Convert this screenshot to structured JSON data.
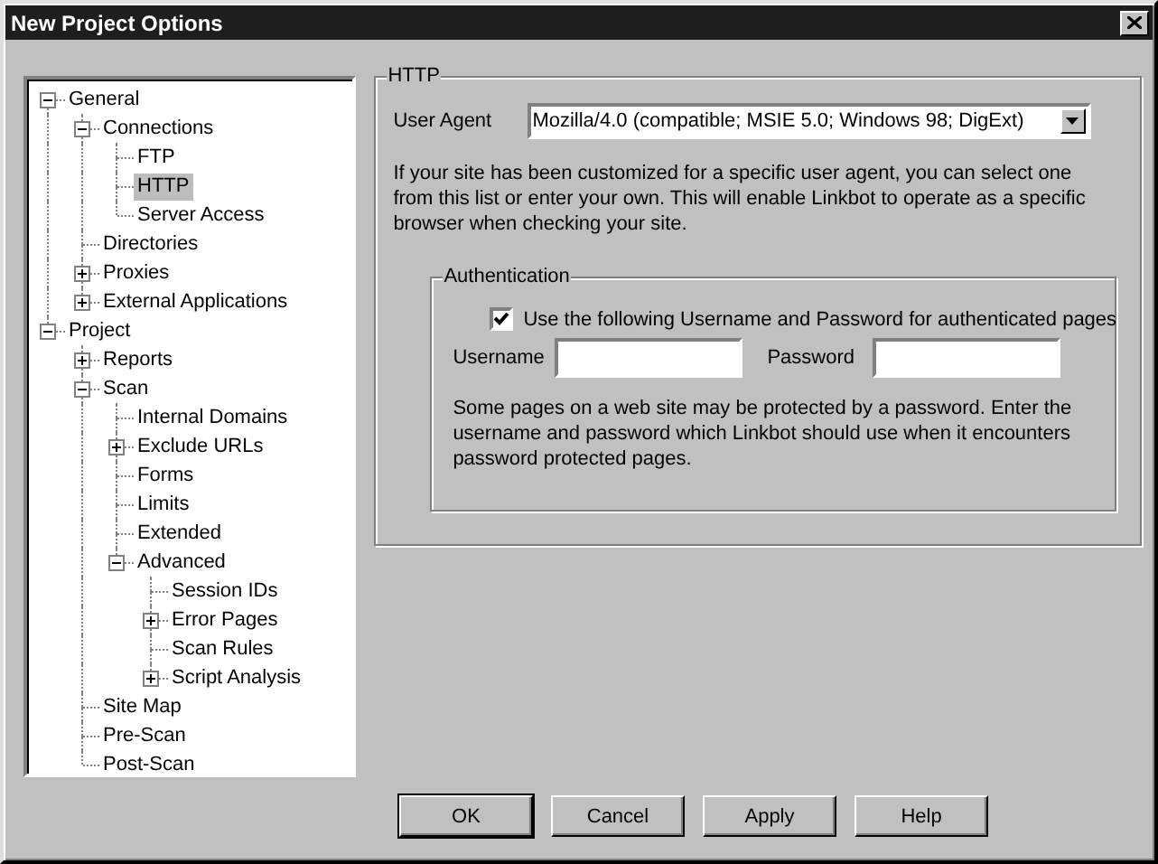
{
  "window": {
    "title": "New Project Options"
  },
  "tree": [
    {
      "label": "General",
      "selected": false,
      "expanded": true,
      "children": [
        {
          "label": "Connections",
          "selected": false,
          "expanded": true,
          "children": [
            {
              "label": "FTP",
              "selected": false
            },
            {
              "label": "HTTP",
              "selected": true
            },
            {
              "label": "Server Access",
              "selected": false
            }
          ]
        },
        {
          "label": "Directories",
          "selected": false
        },
        {
          "label": "Proxies",
          "selected": false,
          "expanded": false
        },
        {
          "label": "External Applications",
          "selected": false,
          "expanded": false
        }
      ]
    },
    {
      "label": "Project",
      "selected": false,
      "expanded": true,
      "children": [
        {
          "label": "Reports",
          "selected": false,
          "expanded": false
        },
        {
          "label": "Scan",
          "selected": false,
          "expanded": true,
          "children": [
            {
              "label": "Internal Domains",
              "selected": false
            },
            {
              "label": "Exclude URLs",
              "selected": false,
              "expanded": false
            },
            {
              "label": "Forms",
              "selected": false
            },
            {
              "label": "Limits",
              "selected": false
            },
            {
              "label": "Extended",
              "selected": false
            },
            {
              "label": "Advanced",
              "selected": false,
              "expanded": true,
              "children": [
                {
                  "label": "Session IDs",
                  "selected": false
                },
                {
                  "label": "Error Pages",
                  "selected": false,
                  "expanded": false
                },
                {
                  "label": "Scan Rules",
                  "selected": false
                },
                {
                  "label": "Script Analysis",
                  "selected": false,
                  "expanded": false
                }
              ]
            }
          ]
        },
        {
          "label": "Site Map",
          "selected": false
        },
        {
          "label": "Pre-Scan",
          "selected": false
        },
        {
          "label": "Post-Scan",
          "selected": false
        }
      ]
    }
  ],
  "panel": {
    "title": "HTTP",
    "user_agent": {
      "label": "User Agent",
      "value": "Mozilla/4.0 (compatible; MSIE 5.0; Windows 98; DigExt)"
    },
    "description": "If your site has been customized for a specific user agent, you can select one from this list or enter your own.  This will enable Linkbot to operate as a specific browser when checking your site.",
    "authentication": {
      "title": "Authentication",
      "use_credentials": {
        "label": "Use the following Username and Password for authenticated pages",
        "checked": true
      },
      "username": {
        "label": "Username"
      },
      "password": {
        "label": "Password"
      },
      "note": "Some pages on a web site may be protected by a password.  Enter the username and password which Linkbot should use when it encounters password protected pages."
    }
  },
  "buttons": [
    {
      "label": "OK",
      "default": true
    },
    {
      "label": "Cancel",
      "default": false
    },
    {
      "label": "Apply",
      "default": false
    },
    {
      "label": "Help",
      "default": false
    }
  ]
}
